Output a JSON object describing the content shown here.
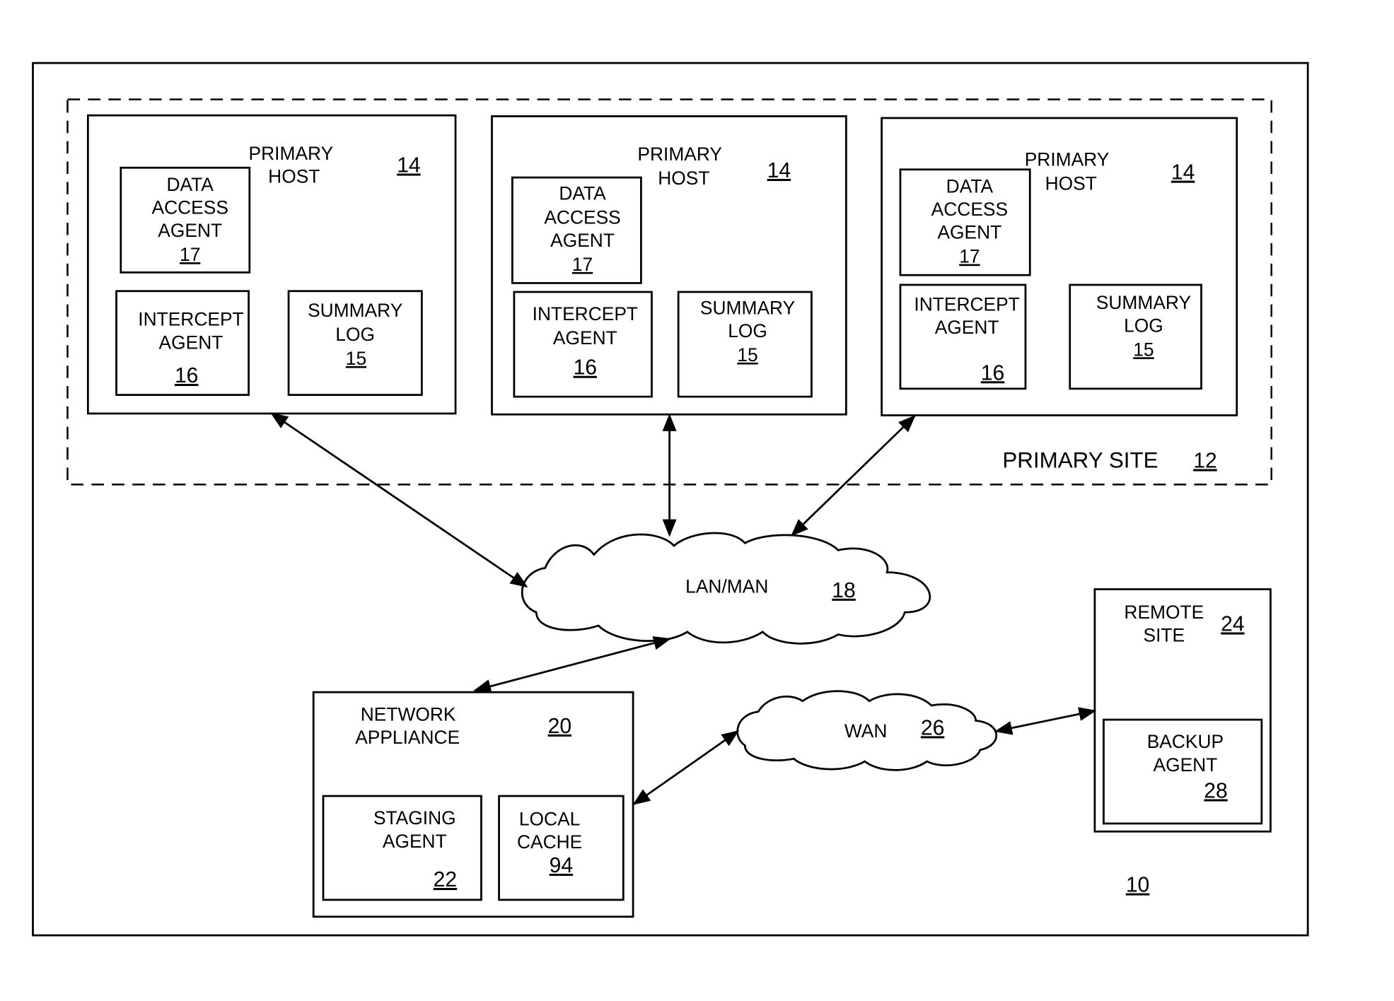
{
  "system": {
    "ref": "10"
  },
  "primary_site": {
    "label": "PRIMARY SITE",
    "ref": "12"
  },
  "primary_hosts": [
    {
      "title_line1": "PRIMARY",
      "title_line2": "HOST",
      "ref": "14",
      "data_access_agent": {
        "l1": "DATA",
        "l2": "ACCESS",
        "l3": "AGENT",
        "ref": "17"
      },
      "intercept_agent": {
        "l1": "INTERCEPT",
        "l2": "AGENT",
        "ref": "16"
      },
      "summary_log": {
        "l1": "SUMMARY",
        "l2": "LOG",
        "ref": "15"
      }
    },
    {
      "title_line1": "PRIMARY",
      "title_line2": "HOST",
      "ref": "14",
      "data_access_agent": {
        "l1": "DATA",
        "l2": "ACCESS",
        "l3": "AGENT",
        "ref": "17"
      },
      "intercept_agent": {
        "l1": "INTERCEPT",
        "l2": "AGENT",
        "ref": "16"
      },
      "summary_log": {
        "l1": "SUMMARY",
        "l2": "LOG",
        "ref": "15"
      }
    },
    {
      "title_line1": "PRIMARY",
      "title_line2": "HOST",
      "ref": "14",
      "data_access_agent": {
        "l1": "DATA",
        "l2": "ACCESS",
        "l3": "AGENT",
        "ref": "17"
      },
      "intercept_agent": {
        "l1": "INTERCEPT",
        "l2": "AGENT",
        "ref": "16"
      },
      "summary_log": {
        "l1": "SUMMARY",
        "l2": "LOG",
        "ref": "15"
      }
    }
  ],
  "lan": {
    "label": "LAN/MAN",
    "ref": "18"
  },
  "network_appliance": {
    "l1": "NETWORK",
    "l2": "APPLIANCE",
    "ref": "20",
    "staging_agent": {
      "l1": "STAGING",
      "l2": "AGENT",
      "ref": "22"
    },
    "local_cache": {
      "l1": "LOCAL",
      "l2": "CACHE",
      "ref": "94"
    }
  },
  "wan": {
    "label": "WAN",
    "ref": "26"
  },
  "remote_site": {
    "l1": "REMOTE",
    "l2": "SITE",
    "ref": "24",
    "backup_agent": {
      "l1": "BACKUP",
      "l2": "AGENT",
      "ref": "28"
    }
  }
}
